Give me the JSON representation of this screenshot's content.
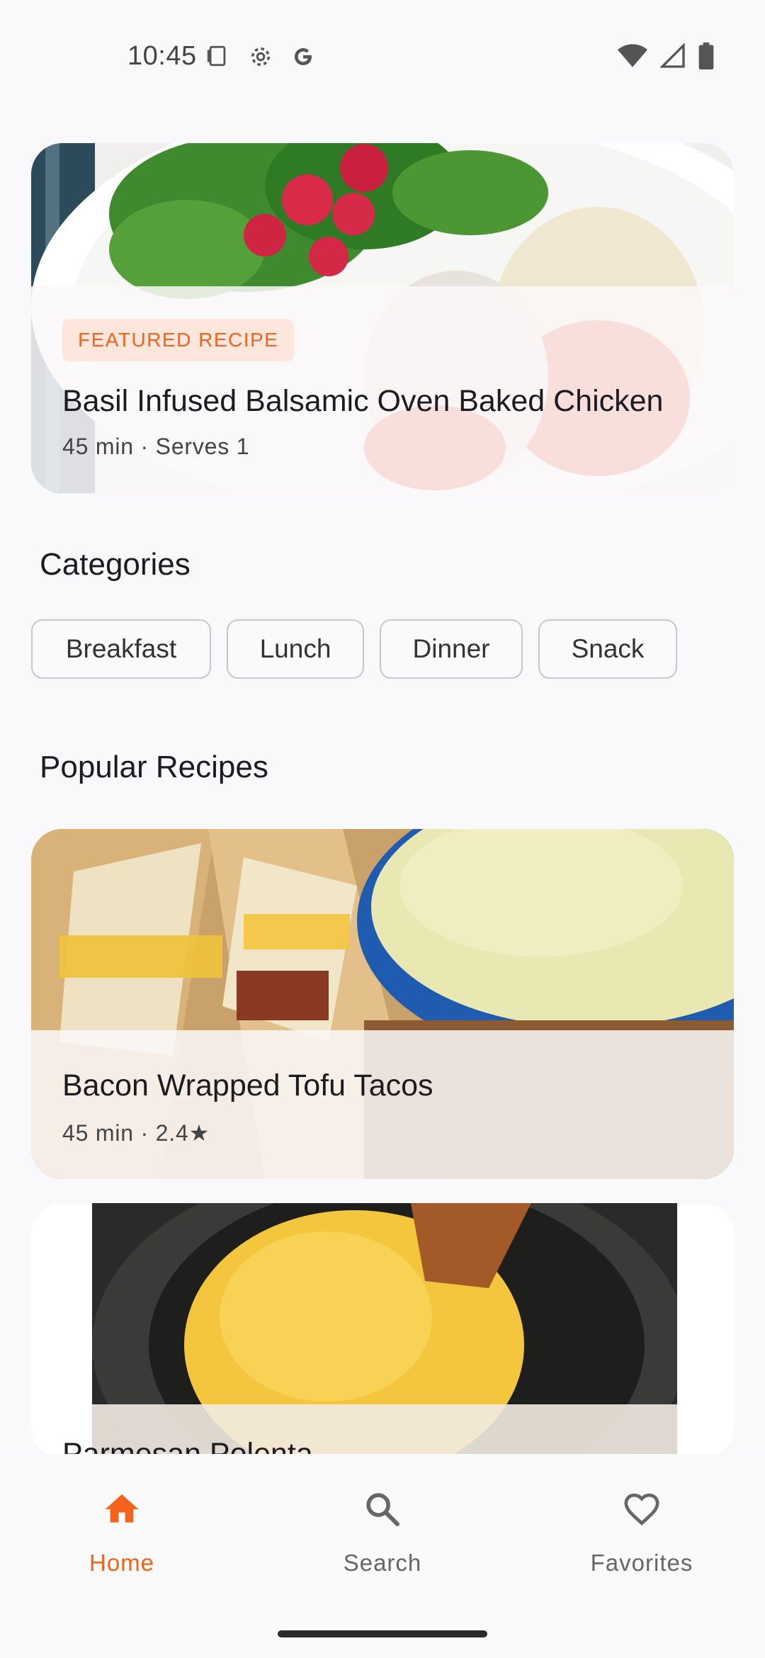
{
  "status_bar": {
    "time": "10:45",
    "icons": [
      "screenshot-icon",
      "settings-gear-icon",
      "google-icon"
    ],
    "right_icons": [
      "wifi-icon",
      "cellular-icon",
      "battery-icon"
    ]
  },
  "featured": {
    "badge": "FEATURED RECIPE",
    "title": "Basil Infused Balsamic Oven Baked Chicken",
    "meta": "45 min · Serves 1"
  },
  "categories": {
    "heading": "Categories",
    "items": [
      "Breakfast",
      "Lunch",
      "Dinner",
      "Snack"
    ]
  },
  "popular": {
    "heading": "Popular Recipes",
    "recipes": [
      {
        "title": "Bacon Wrapped Tofu Tacos",
        "meta": "45 min · 2.4★"
      },
      {
        "title": "Parmesan Polenta",
        "meta": ""
      }
    ]
  },
  "bottom_nav": {
    "items": [
      {
        "label": "Home",
        "icon": "home-icon",
        "active": true
      },
      {
        "label": "Search",
        "icon": "search-icon",
        "active": false
      },
      {
        "label": "Favorites",
        "icon": "heart-icon",
        "active": false
      }
    ]
  },
  "colors": {
    "accent": "#f4621c",
    "background": "#f9f9fb",
    "badge_bg": "#fde7dc"
  }
}
